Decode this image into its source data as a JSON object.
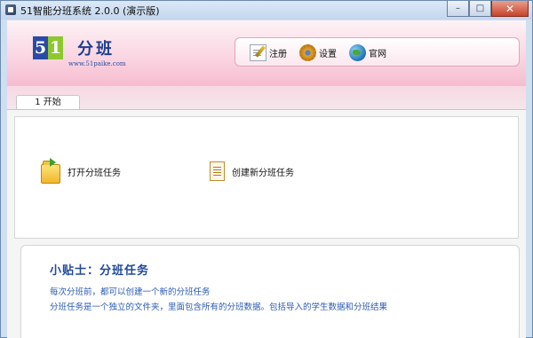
{
  "window": {
    "title": "51智能分班系统 2.0.0 (演示版)",
    "controls": {
      "minimize": "–",
      "maximize": "□",
      "close": "✕"
    }
  },
  "logo": {
    "digit1": "5",
    "digit2": "1",
    "word": "分班",
    "url": "www.51paike.com"
  },
  "toolbar": {
    "register_label": "注册",
    "settings_label": "设置",
    "website_label": "官网"
  },
  "tabs": [
    {
      "label": "1 开始",
      "active": true
    }
  ],
  "actions": {
    "open_task": "打开分班任务",
    "create_task": "创建新分班任务"
  },
  "tips": {
    "title": "小贴士：分班任务",
    "line1": "每次分班前，都可以创建一个新的分班任务",
    "line2": "分班任务是一个独立的文件夹，里面包含所有的分班数据。包括导入的学生数据和分班结果"
  },
  "colors": {
    "banner_pink": "#f6bcd0",
    "logo_blue": "#2b4aa5",
    "logo_green": "#8cc82e",
    "tips_blue": "#2b5bb5",
    "close_red": "#c7432b"
  },
  "icons": {
    "register": "pen-paper-icon",
    "settings": "gear-icon",
    "website": "globe-icon",
    "open_task": "open-folder-icon",
    "create_task": "document-icon"
  }
}
